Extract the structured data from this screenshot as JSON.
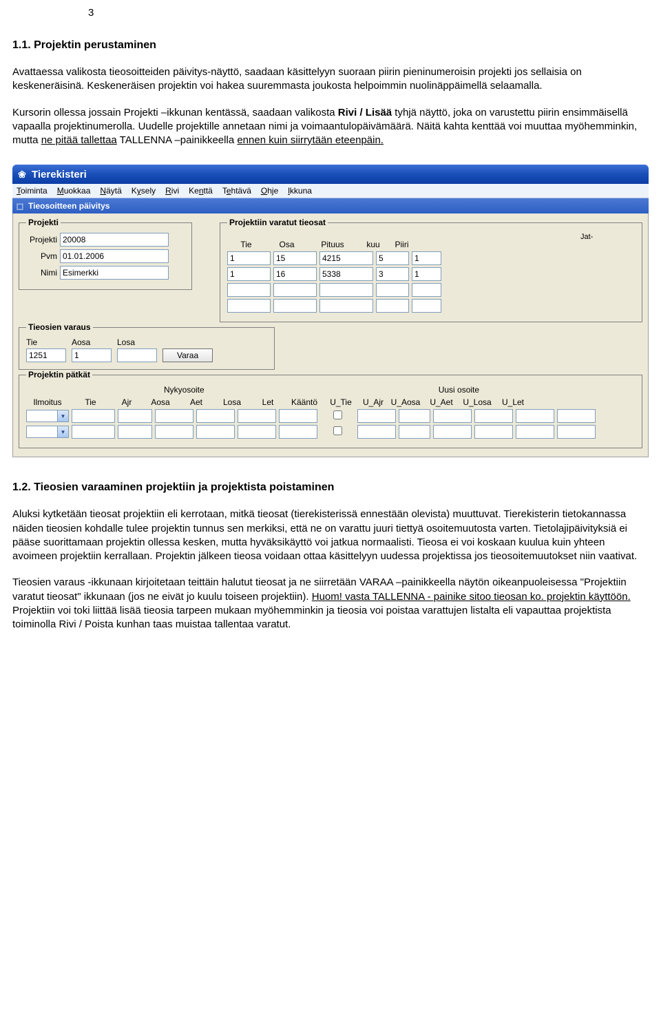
{
  "page_number": "3",
  "section1": {
    "title": "1.1. Projektin perustaminen",
    "para1": "Avattaessa valikosta tieosoitteiden päivitys-näyttö, saadaan käsittelyyn suoraan piirin pieninumeroisin projekti jos sellaisia on keskeneräisinä. Keskeneräisen projektin voi hakea suuremmasta joukosta helpoimmin nuolinäppäimellä selaamalla.",
    "para2_pre": "Kursorin ollessa jossain Projekti –ikkunan kentässä, saadaan valikosta ",
    "para2_bold": "Rivi / Lisää",
    "para2_mid": " tyhjä näyttö, joka on varustettu piirin ensimmäisellä vapaalla projektinumerolla. Uudelle projektille annetaan nimi ja voimaantulopäivämäärä. Näitä kahta kenttää voi muuttaa myöhemminkin, mutta ",
    "para2_u1": "ne pitää tallettaa",
    "para2_mid2": " TALLENNA –painikkeella ",
    "para2_u2": "ennen kuin siirrytään eteenpäin.",
    "para2_end": ""
  },
  "app": {
    "title": "Tierekisteri",
    "menu": [
      "Toiminta",
      "Muokkaa",
      "Näytä",
      "Kysely",
      "Rivi",
      "Kenttä",
      "Tehtävä",
      "Ohje",
      "Ikkuna"
    ],
    "subwindow_title": "Tieosoitteen päivitys",
    "projekti": {
      "legend": "Projekti",
      "label_projekti": "Projekti",
      "val_projekti": "20008",
      "label_pvm": "Pvm",
      "val_pvm": "01.01.2006",
      "label_nimi": "Nimi",
      "val_nimi": "Esimerkki"
    },
    "varatut": {
      "legend": "Projektiin varatut tieosat",
      "head_jat": "Jat-",
      "cols": [
        "Tie",
        "Osa",
        "Pituus",
        "kuu",
        "Piiri"
      ],
      "rows": [
        {
          "tie": "1",
          "osa": "15",
          "pituus": "4215",
          "jatkuu": "5",
          "piiri": "1"
        },
        {
          "tie": "1",
          "osa": "16",
          "pituus": "5338",
          "jatkuu": "3",
          "piiri": "1"
        },
        {
          "tie": "",
          "osa": "",
          "pituus": "",
          "jatkuu": "",
          "piiri": ""
        },
        {
          "tie": "",
          "osa": "",
          "pituus": "",
          "jatkuu": "",
          "piiri": ""
        }
      ]
    },
    "varaus": {
      "legend": "Tieosien varaus",
      "cols": [
        "Tie",
        "Aosa",
        "Losa"
      ],
      "tie": "1251",
      "aosa": "1",
      "losa": "",
      "btn": "Varaa"
    },
    "patkat": {
      "legend": "Projektin pätkät",
      "super_left": "Nykyosoite",
      "super_right": "Uusi osoite",
      "cols": [
        "Ilmoitus",
        "Tie",
        "Ajr",
        "Aosa",
        "Aet",
        "Losa",
        "Let",
        "Kääntö",
        "U_Tie",
        "U_Ajr",
        "U_Aosa",
        "U_Aet",
        "U_Losa",
        "U_Let"
      ]
    }
  },
  "section2": {
    "title": "1.2. Tieosien varaaminen projektiin ja projektista poistaminen",
    "para1": "Aluksi kytketään tieosat projektiin eli kerrotaan, mitkä tieosat (tierekisterissä ennestään olevista) muuttuvat.  Tierekisterin tietokannassa näiden tieosien kohdalle tulee projektin tunnus sen merkiksi, että ne on varattu juuri tiettyä osoitemuutosta varten. Tietolajipäivityksiä ei pääse suorittamaan projektin ollessa kesken, mutta hyväksikäyttö voi jatkua normaalisti. Tieosa ei voi koskaan kuulua kuin yhteen avoimeen projektiin kerrallaan.  Projektin jälkeen tieosa voidaan ottaa käsittelyyn uudessa projektissa jos tieosoitemuutokset niin vaativat.",
    "para2_a": "Tieosien varaus -ikkunaan kirjoitetaan teittäin halutut tieosat ja ne siirretään  VARAA –painikkeella näytön oikeanpuoleisessa \"Projektiin varatut tieosat\" ikkunaan (jos ne eivät jo kuulu toiseen projektiin). ",
    "para2_u": "Huom! vasta TALLENNA - painike sitoo tieosan ko. projektin käyttöön.",
    "para2_b": " Projektiin voi toki liittää lisää tieosia tarpeen mukaan myöhemminkin ja tieosia voi poistaa varattujen listalta eli vapauttaa projektista toiminolla Rivi / Poista kunhan taas muistaa tallentaa varatut."
  }
}
